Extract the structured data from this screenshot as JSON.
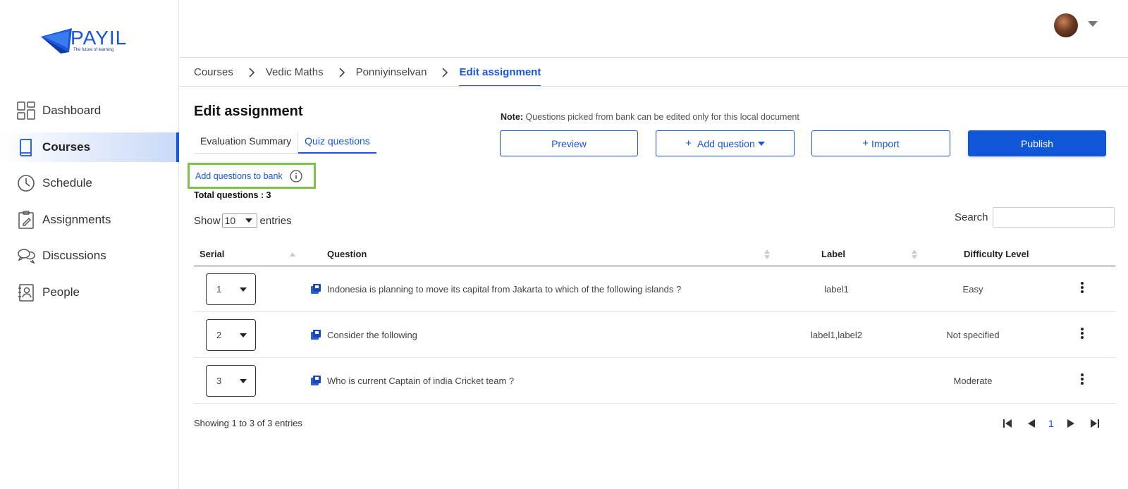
{
  "brand": {
    "name": "PAYIL",
    "tagline": "The future of learning"
  },
  "sidebar": {
    "items": [
      {
        "label": "Dashboard",
        "icon": "dashboard-icon"
      },
      {
        "label": "Courses",
        "icon": "book-icon",
        "active": true
      },
      {
        "label": "Schedule",
        "icon": "clock-icon"
      },
      {
        "label": "Assignments",
        "icon": "clipboard-icon"
      },
      {
        "label": "Discussions",
        "icon": "chat-icon"
      },
      {
        "label": "People",
        "icon": "person-icon"
      }
    ]
  },
  "breadcrumb": [
    "Courses",
    "Vedic Maths",
    "Ponniyinselvan",
    "Edit assignment"
  ],
  "page": {
    "title": "Edit assignment",
    "tabs": [
      "Evaluation Summary",
      "Quiz questions"
    ],
    "note_label": "Note:",
    "note_text": " Questions picked from bank can be edited only for this local document",
    "buttons": {
      "preview": "Preview",
      "add_question": "Add question",
      "import": "Import",
      "publish": "Publish"
    },
    "bank_link": "Add questions to bank",
    "total": "Total questions : 3"
  },
  "table_controls": {
    "show": "Show",
    "entries_value": "10",
    "entries": "entries",
    "search_label": "Search",
    "search_value": ""
  },
  "table": {
    "headers": {
      "serial": "Serial",
      "question": "Question",
      "label": "Label",
      "difficulty": "Difficulty Level"
    },
    "rows": [
      {
        "serial": "1",
        "question": "Indonesia is planning to move its capital from Jakarta to which of the following islands ?",
        "label": "label1",
        "difficulty": "Easy"
      },
      {
        "serial": "2",
        "question": "Consider the following",
        "label": "label1,label2",
        "difficulty": "Not specified"
      },
      {
        "serial": "3",
        "question": "Who is current Captain of india Cricket team ?",
        "label": "",
        "difficulty": "Moderate"
      }
    ]
  },
  "footer": {
    "showing": "Showing 1 to 3 of 3 entries",
    "page": "1"
  },
  "colors": {
    "accent": "#1a56db",
    "highlight": "#7dc24f"
  }
}
